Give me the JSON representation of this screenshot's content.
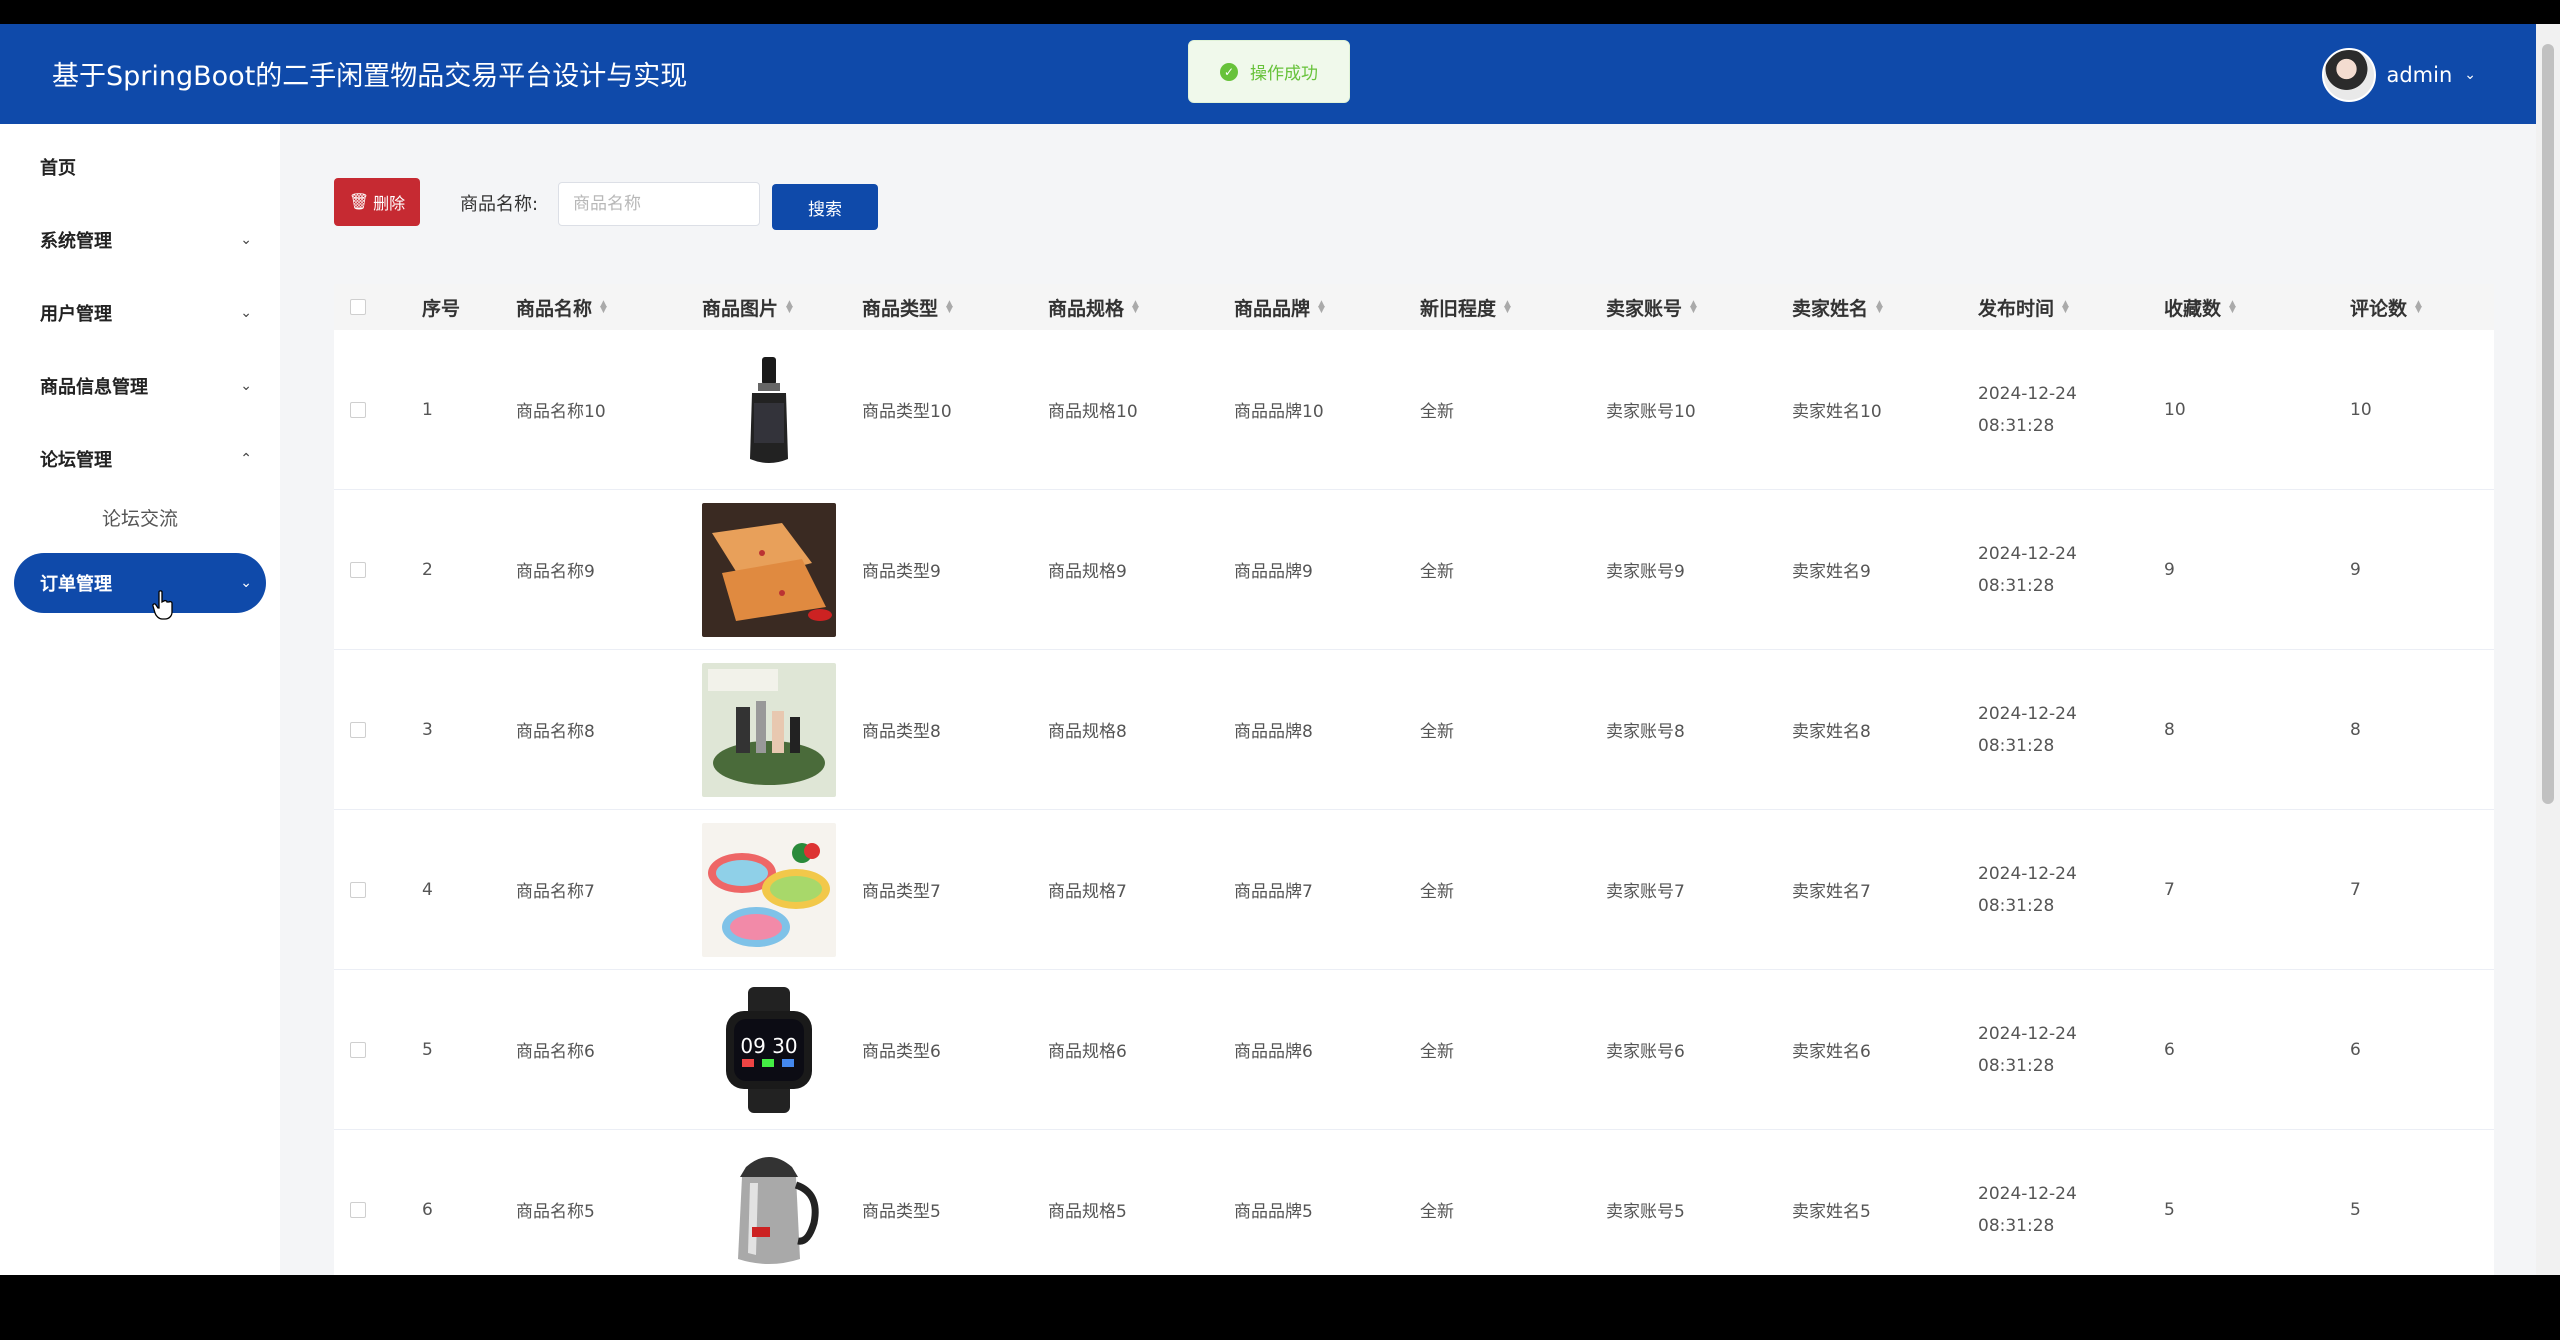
{
  "header": {
    "title": "基于SpringBoot的二手闲置物品交易平台设计与实现",
    "user": "admin"
  },
  "toast": {
    "text": "操作成功"
  },
  "sidebar": {
    "items": [
      {
        "label": "首页"
      },
      {
        "label": "系统管理"
      },
      {
        "label": "用户管理"
      },
      {
        "label": "商品信息管理"
      },
      {
        "label": "论坛管理"
      },
      {
        "label": "订单管理"
      }
    ],
    "sub_items": [
      {
        "label": "论坛交流"
      }
    ]
  },
  "toolbar": {
    "delete_label": "删除",
    "search_label": "商品名称:",
    "search_placeholder": "商品名称",
    "search_button": "搜索"
  },
  "table": {
    "headers": [
      "序号",
      "商品名称",
      "商品图片",
      "商品类型",
      "商品规格",
      "商品品牌",
      "新旧程度",
      "卖家账号",
      "卖家姓名",
      "发布时间",
      "收藏数",
      "评论数"
    ],
    "rows": [
      {
        "no": "1",
        "name": "商品名称10",
        "image": "serum-bottle",
        "type": "商品类型10",
        "spec": "商品规格10",
        "brand": "商品品牌10",
        "condition": "全新",
        "account": "卖家账号10",
        "seller": "卖家姓名10",
        "time": "2024-12-24 08:31:28",
        "fav": "10",
        "comments": "10"
      },
      {
        "no": "2",
        "name": "商品名称9",
        "image": "tofu-snack",
        "type": "商品类型9",
        "spec": "商品规格9",
        "brand": "商品品牌9",
        "condition": "全新",
        "account": "卖家账号9",
        "seller": "卖家姓名9",
        "time": "2024-12-24 08:31:28",
        "fav": "9",
        "comments": "9"
      },
      {
        "no": "3",
        "name": "商品名称8",
        "image": "cosmetic-organizer",
        "type": "商品类型8",
        "spec": "商品规格8",
        "brand": "商品品牌8",
        "condition": "全新",
        "account": "卖家账号8",
        "seller": "卖家姓名8",
        "time": "2024-12-24 08:31:28",
        "fav": "8",
        "comments": "8"
      },
      {
        "no": "4",
        "name": "商品名称7",
        "image": "colander-baskets",
        "type": "商品类型7",
        "spec": "商品规格7",
        "brand": "商品品牌7",
        "condition": "全新",
        "account": "卖家账号7",
        "seller": "卖家姓名7",
        "time": "2024-12-24 08:31:28",
        "fav": "7",
        "comments": "7"
      },
      {
        "no": "5",
        "name": "商品名称6",
        "image": "smart-watch",
        "type": "商品类型6",
        "spec": "商品规格6",
        "brand": "商品品牌6",
        "condition": "全新",
        "account": "卖家账号6",
        "seller": "卖家姓名6",
        "time": "2024-12-24 08:31:28",
        "fav": "6",
        "comments": "6"
      },
      {
        "no": "6",
        "name": "商品名称5",
        "image": "electric-kettle",
        "type": "商品类型5",
        "spec": "商品规格5",
        "brand": "商品品牌5",
        "condition": "全新",
        "account": "卖家账号5",
        "seller": "卖家姓名5",
        "time": "2024-12-24 08:31:28",
        "fav": "5",
        "comments": "5"
      }
    ]
  }
}
